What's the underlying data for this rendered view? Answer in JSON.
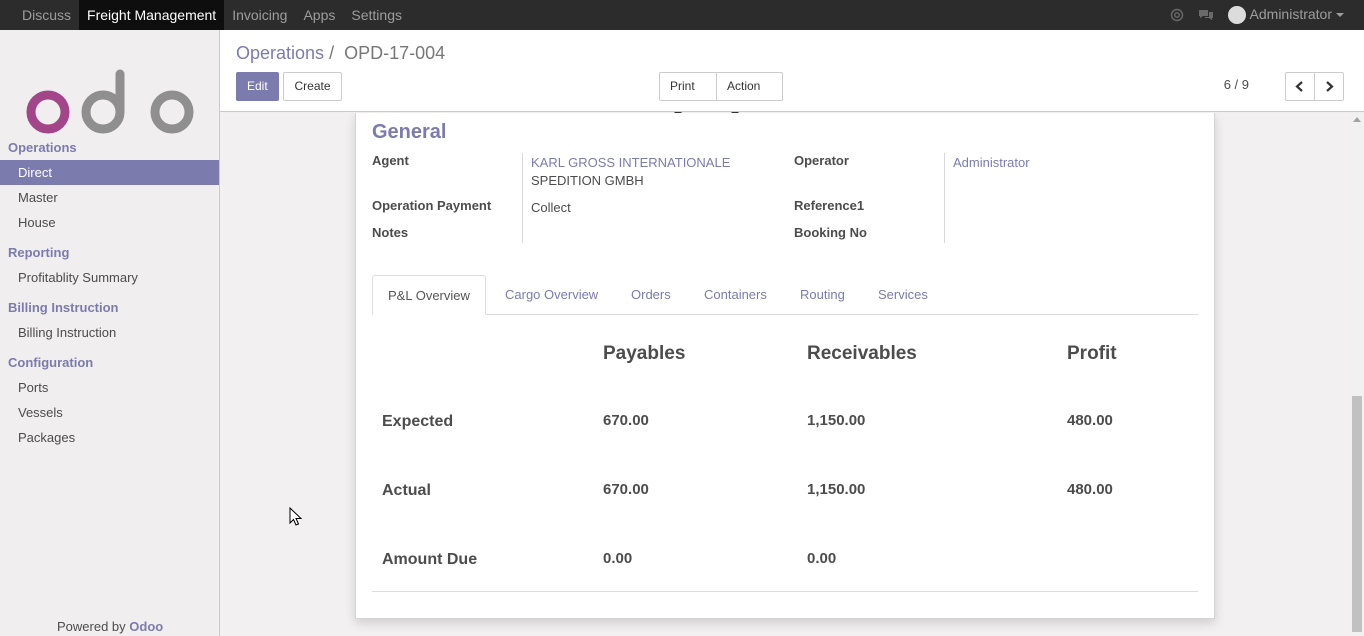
{
  "topbar": {
    "menu": [
      "Discuss",
      "Freight Management",
      "Invoicing",
      "Apps",
      "Settings"
    ],
    "active_index": 1,
    "user": "Administrator"
  },
  "sidebar": {
    "logo_text": "odoo",
    "sections": [
      {
        "title": "Operations",
        "items": [
          "Direct",
          "Master",
          "House"
        ]
      },
      {
        "title": "Reporting",
        "items": [
          "Profitablity Summary"
        ]
      },
      {
        "title": "Billing Instruction",
        "items": [
          "Billing Instruction"
        ]
      },
      {
        "title": "Configuration",
        "items": [
          "Ports",
          "Vessels",
          "Packages"
        ]
      }
    ],
    "active_item": "Direct",
    "powered_prefix": "Powered by",
    "powered_brand": "Odoo"
  },
  "control_panel": {
    "breadcrumb_parent": "Operations",
    "breadcrumb_sep": "/",
    "breadcrumb_current": "OPD-17-004",
    "edit_label": "Edit",
    "create_label": "Create",
    "print_label": "Print",
    "action_label": "Action",
    "pager": "6 / 9"
  },
  "form": {
    "section_title": "General",
    "agent_label": "Agent",
    "agent_value_line1": "KARL GROSS INTERNATIONALE",
    "agent_value_line2": "SPEDITION GMBH",
    "operation_payment_label": "Operation Payment",
    "operation_payment_value": "Collect",
    "notes_label": "Notes",
    "operator_label": "Operator",
    "operator_value": "Administrator",
    "reference1_label": "Reference1",
    "booking_no_label": "Booking No"
  },
  "tabs": [
    "P&L Overview",
    "Cargo Overview",
    "Orders",
    "Containers",
    "Routing",
    "Services"
  ],
  "pl": {
    "headers": [
      "Payables",
      "Receivables",
      "Profit"
    ],
    "rows": [
      {
        "label": "Expected",
        "payables": "670.00",
        "receivables": "1,150.00",
        "profit": "480.00"
      },
      {
        "label": "Actual",
        "payables": "670.00",
        "receivables": "1,150.00",
        "profit": "480.00"
      },
      {
        "label": "Amount Due",
        "payables": "0.00",
        "receivables": "0.00",
        "profit": ""
      }
    ]
  },
  "colors": {
    "brand": "#7c7bad",
    "topbar": "#2c2c2c",
    "topbar_active": "#0e0e0e"
  }
}
